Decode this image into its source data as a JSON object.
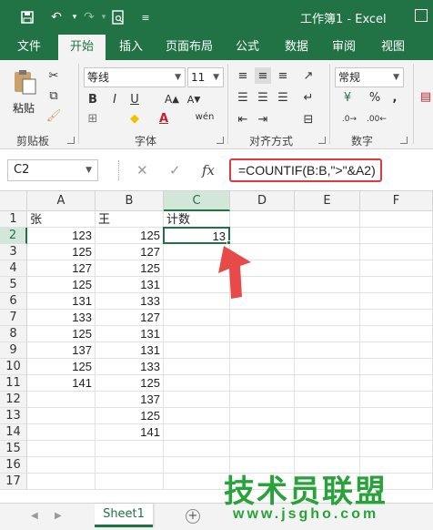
{
  "window": {
    "title": "工作簿1 - Excel"
  },
  "quick_access": {
    "icons": [
      "save-icon",
      "undo-icon",
      "redo-icon",
      "print-preview-icon",
      "customize-icon"
    ]
  },
  "tabs": [
    {
      "label": "文件"
    },
    {
      "label": "开始"
    },
    {
      "label": "插入"
    },
    {
      "label": "页面布局"
    },
    {
      "label": "公式"
    },
    {
      "label": "数据"
    },
    {
      "label": "审阅"
    },
    {
      "label": "视图"
    }
  ],
  "ribbon": {
    "clipboard": {
      "label": "剪贴板",
      "paste_label": "粘贴"
    },
    "font": {
      "label": "字体",
      "font_name": "等线",
      "font_size": "11",
      "bold": "B",
      "italic": "I",
      "underline": "U",
      "phonetic": "wén"
    },
    "alignment": {
      "label": "对齐方式"
    },
    "number": {
      "label": "数字",
      "format": "常规",
      "percent": "%",
      "comma": ","
    }
  },
  "formula_bar": {
    "name_box": "C2",
    "cancel": "✕",
    "enter": "✓",
    "fx": "fx",
    "formula": "=COUNTIF(B:B,\">\"&A2)"
  },
  "columns": [
    "A",
    "B",
    "C",
    "D",
    "E",
    "F"
  ],
  "rows": [
    "1",
    "2",
    "3",
    "4",
    "5",
    "6",
    "7",
    "8",
    "9",
    "10",
    "11",
    "12",
    "13",
    "14",
    "15",
    "16",
    "17"
  ],
  "cells": {
    "A": [
      "张",
      "123",
      "125",
      "127",
      "125",
      "131",
      "133",
      "125",
      "137",
      "125",
      "141",
      "",
      "",
      "",
      "",
      "",
      ""
    ],
    "B": [
      "王",
      "125",
      "127",
      "125",
      "131",
      "133",
      "127",
      "131",
      "131",
      "133",
      "125",
      "137",
      "125",
      "141",
      "",
      "",
      ""
    ],
    "C": [
      "计数",
      "13",
      "",
      "",
      "",
      "",
      "",
      "",
      "",
      "",
      "",
      "",
      "",
      "",
      "",
      "",
      ""
    ]
  },
  "selected_cell": "C2",
  "sheet": {
    "tab_label": "Sheet1",
    "add_label": "+"
  },
  "watermark": {
    "text": "技术员联盟",
    "url": "www.jsgho.com"
  },
  "colors": {
    "brand": "#217346",
    "highlight_box": "#e03a3a",
    "arrow": "#e84a4a",
    "watermark": "#27a33a"
  }
}
